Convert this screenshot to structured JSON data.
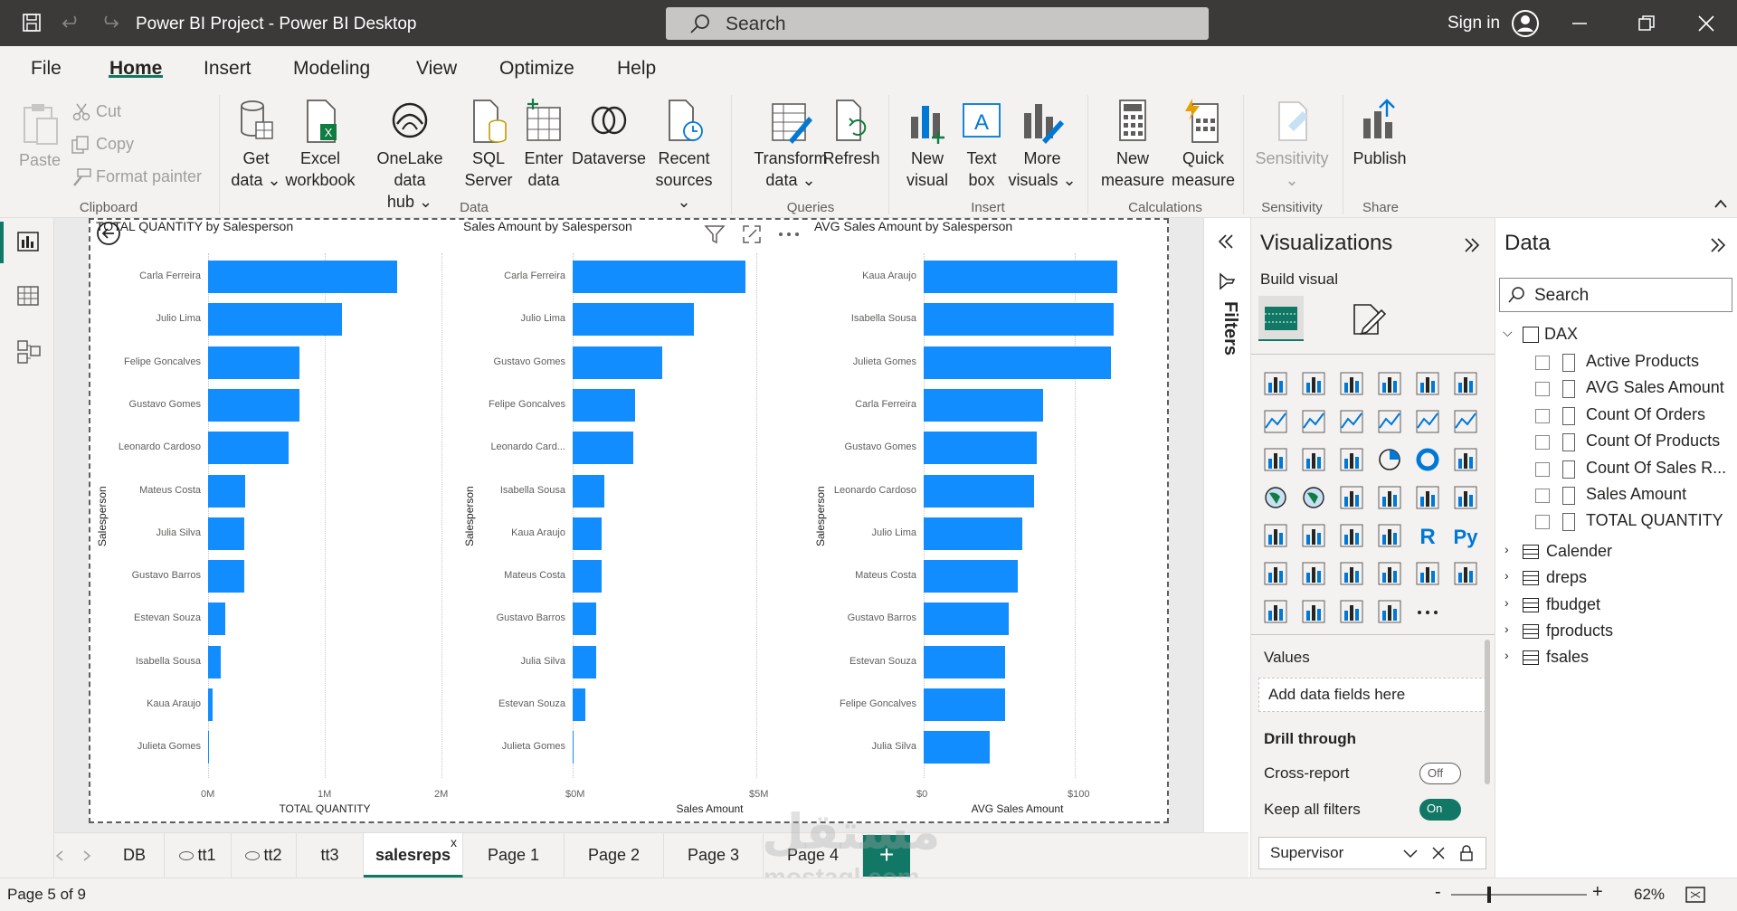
{
  "window": {
    "title": "Power BI Project - Power BI Desktop",
    "search_placeholder": "Search",
    "signin": "Sign in"
  },
  "menu": [
    "File",
    "Home",
    "Insert",
    "Modeling",
    "View",
    "Optimize",
    "Help"
  ],
  "ribbon": {
    "clipboard": {
      "paste": "Paste",
      "cut": "Cut",
      "copy": "Copy",
      "format_painter": "Format painter",
      "group": "Clipboard"
    },
    "data": {
      "get_data": [
        "Get",
        "data"
      ],
      "excel": [
        "Excel",
        "workbook"
      ],
      "onelake": [
        "OneLake data",
        "hub"
      ],
      "sql": [
        "SQL",
        "Server"
      ],
      "enter": [
        "Enter",
        "data"
      ],
      "dataverse": "Dataverse",
      "recent": [
        "Recent",
        "sources"
      ],
      "group": "Data"
    },
    "queries": {
      "transform": [
        "Transform",
        "data"
      ],
      "refresh": "Refresh",
      "group": "Queries"
    },
    "insert": {
      "new_visual": [
        "New",
        "visual"
      ],
      "text_box": [
        "Text",
        "box"
      ],
      "more_visuals": [
        "More",
        "visuals"
      ],
      "group": "Insert"
    },
    "calculations": {
      "new_measure": [
        "New",
        "measure"
      ],
      "quick_measure": [
        "Quick",
        "measure"
      ],
      "group": "Calculations"
    },
    "sensitivity": {
      "label": "Sensitivity",
      "group": "Sensitivity"
    },
    "share": {
      "publish": "Publish",
      "group": "Share"
    }
  },
  "charts": [
    {
      "title": "TOTAL QUANTITY by Salesperson",
      "ytitle": "Salesperson",
      "xtitle": "TOTAL QUANTITY",
      "ticks": [
        "0M",
        "1M",
        "2M"
      ],
      "categories": [
        "Carla Ferreira",
        "Julio Lima",
        "Felipe Goncalves",
        "Gustavo Gomes",
        "Leonardo Cardoso",
        "Mateus Costa",
        "Julia Silva",
        "Gustavo Barros",
        "Estevan Souza",
        "Isabella Sousa",
        "Kaua Araujo",
        "Julieta Gomes"
      ],
      "values": [
        1.62,
        1.15,
        0.78,
        0.78,
        0.69,
        0.32,
        0.31,
        0.31,
        0.15,
        0.11,
        0.04,
        0.01
      ],
      "max": 2
    },
    {
      "title": "Sales Amount by Salesperson",
      "ytitle": "Salesperson",
      "xtitle": "Sales Amount",
      "ticks": [
        "$0M",
        "$5M"
      ],
      "categories": [
        "Carla Ferreira",
        "Julio Lima",
        "Gustavo Gomes",
        "Felipe Goncalves",
        "Leonardo Card...",
        "Isabella Sousa",
        "Kaua Araujo",
        "Mateus Costa",
        "Gustavo Barros",
        "Julia Silva",
        "Estevan Souza",
        "Julieta Gomes"
      ],
      "values": [
        4.7,
        3.3,
        2.45,
        1.7,
        1.65,
        0.85,
        0.8,
        0.78,
        0.65,
        0.65,
        0.35,
        0.02
      ],
      "max": 5
    },
    {
      "title": "AVG Sales Amount by Salesperson",
      "ytitle": "Salesperson",
      "xtitle": "AVG Sales Amount",
      "ticks": [
        "$0",
        "$100"
      ],
      "categories": [
        "Kaua Araujo",
        "Isabella Sousa",
        "Julieta Gomes",
        "Carla Ferreira",
        "Gustavo Gomes",
        "Leonardo Cardoso",
        "Julio Lima",
        "Mateus Costa",
        "Gustavo Barros",
        "Estevan Souza",
        "Felipe Goncalves",
        "Julia Silva"
      ],
      "values": [
        128,
        126,
        124,
        79,
        75,
        73,
        65,
        62,
        56,
        54,
        54,
        44
      ],
      "max": 100
    }
  ],
  "filters_label": "Filters",
  "viz": {
    "title": "Visualizations",
    "build_visual": "Build visual",
    "values": "Values",
    "add_fields": "Add data fields here",
    "drill_through": "Drill through",
    "cross_report": "Cross-report",
    "cross_report_state": "Off",
    "keep_filters": "Keep all filters",
    "keep_filters_state": "On",
    "supervisor": "Supervisor"
  },
  "data_pane": {
    "title": "Data",
    "search_placeholder": "Search",
    "dax_table": "DAX",
    "measures": [
      "Active Products",
      "AVG Sales Amount",
      "Count Of Orders",
      "Count Of Products",
      "Count Of Sales R...",
      "Sales Amount",
      "TOTAL QUANTITY"
    ],
    "tables": [
      "Calender",
      "dreps",
      "fbudget",
      "fproducts",
      "fsales"
    ]
  },
  "tabs": [
    "DB",
    "tt1",
    "tt2",
    "tt3",
    "salesreps",
    "Page 1",
    "Page 2",
    "Page 3",
    "Page 4"
  ],
  "active_tab": "salesreps",
  "status": {
    "page": "Page 5 of 9",
    "zoom": "62%"
  },
  "watermark": {
    "arabic": "مستقل",
    "latin": "mostaql.com"
  },
  "colors": {
    "bar": "#118dff",
    "accent": "#117865",
    "titlebar": "#3b3a39"
  }
}
